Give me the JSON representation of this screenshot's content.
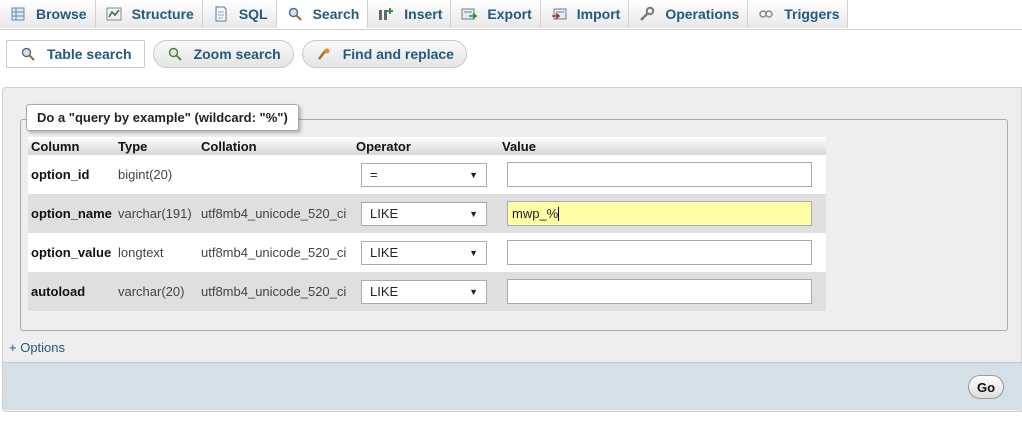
{
  "tabs": [
    {
      "label": "Browse",
      "icon": "browse-icon"
    },
    {
      "label": "Structure",
      "icon": "structure-icon"
    },
    {
      "label": "SQL",
      "icon": "sql-icon"
    },
    {
      "label": "Search",
      "icon": "search-icon",
      "active": true
    },
    {
      "label": "Insert",
      "icon": "insert-icon"
    },
    {
      "label": "Export",
      "icon": "export-icon"
    },
    {
      "label": "Import",
      "icon": "import-icon"
    },
    {
      "label": "Operations",
      "icon": "wrench-icon"
    },
    {
      "label": "Triggers",
      "icon": "triggers-icon"
    }
  ],
  "subtabs": [
    {
      "label": "Table search",
      "icon": "magnifier-icon",
      "active": true
    },
    {
      "label": "Zoom search",
      "icon": "zoom-icon"
    },
    {
      "label": "Find and replace",
      "icon": "find-replace-icon"
    }
  ],
  "search": {
    "legend": "Do a \"query by example\" (wildcard: \"%\")",
    "headers": {
      "column": "Column",
      "type": "Type",
      "collation": "Collation",
      "operator": "Operator",
      "value": "Value"
    },
    "rows": [
      {
        "column": "option_id",
        "type": "bigint(20)",
        "collation": "",
        "operator": "=",
        "value": ""
      },
      {
        "column": "option_name",
        "type": "varchar(191)",
        "collation": "utf8mb4_unicode_520_ci",
        "operator": "LIKE",
        "value": "mwp_%"
      },
      {
        "column": "option_value",
        "type": "longtext",
        "collation": "utf8mb4_unicode_520_ci",
        "operator": "LIKE",
        "value": ""
      },
      {
        "column": "autoload",
        "type": "varchar(20)",
        "collation": "utf8mb4_unicode_520_ci",
        "operator": "LIKE",
        "value": ""
      }
    ],
    "options_link": "+ Options",
    "go_label": "Go"
  },
  "colors": {
    "link": "#235a81",
    "highlight_input": "#ffffa8",
    "footer": "#d5dfe6"
  }
}
